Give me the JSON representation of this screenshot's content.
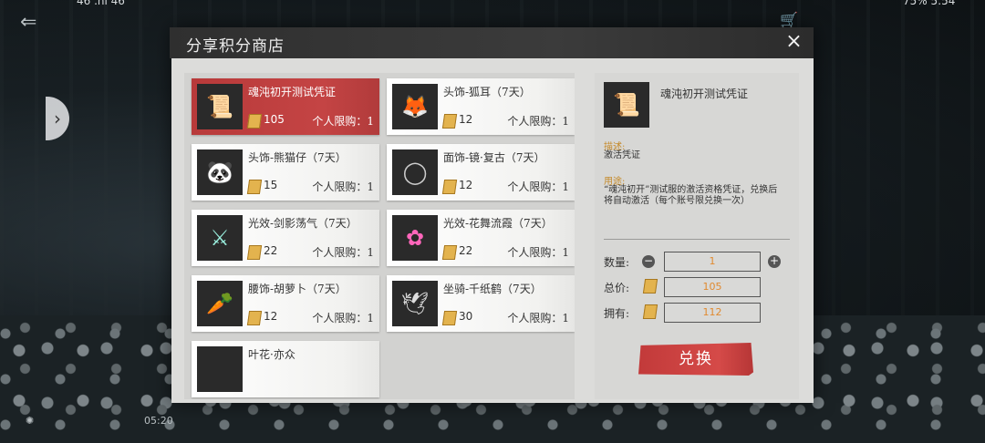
{
  "shop": {
    "title": "分享积分商店",
    "close_icon": "×",
    "items": [
      {
        "name": "魂沌初开测试凭证",
        "price": "105",
        "limit": "个人限购：1",
        "icon": "ticket-icon",
        "glyph": "📜"
      },
      {
        "name": "头饰-狐耳（7天）",
        "price": "12",
        "limit": "个人限购：1",
        "icon": "fox-ears-icon",
        "glyph": "🦊"
      },
      {
        "name": "头饰-熊猫仔（7天）",
        "price": "15",
        "limit": "个人限购：1",
        "icon": "panda-icon",
        "glyph": "🐼"
      },
      {
        "name": "面饰-镜·复古（7天）",
        "price": "12",
        "limit": "个人限购：1",
        "icon": "monocle-icon",
        "glyph": "◯"
      },
      {
        "name": "光效-剑影荡气（7天）",
        "price": "22",
        "limit": "个人限购：1",
        "icon": "sword-effect-icon",
        "glyph": "⚔"
      },
      {
        "name": "光效-花舞流霞（7天）",
        "price": "22",
        "limit": "个人限购：1",
        "icon": "flower-effect-icon",
        "glyph": "✿"
      },
      {
        "name": "腰饰-胡萝卜（7天）",
        "price": "12",
        "limit": "个人限购：1",
        "icon": "carrot-icon",
        "glyph": "🥕"
      },
      {
        "name": "坐骑-千纸鹤（7天）",
        "price": "30",
        "limit": "个人限购：1",
        "icon": "paper-crane-icon",
        "glyph": "🕊"
      },
      {
        "name": "叶花·亦众",
        "price": "",
        "limit": "",
        "icon": "partial-item-icon",
        "glyph": ""
      }
    ]
  },
  "detail": {
    "name": "魂沌初开测试凭证",
    "desc_label": "描述:",
    "desc_text": "激活凭证",
    "usage_label": "用途:",
    "usage_text": "“魂沌初开”测试服的激活资格凭证，兑换后将自动激活（每个账号限兑换一次）",
    "qty_label": "数量:",
    "qty_value": "1",
    "total_label": "总价:",
    "total_value": "105",
    "owned_label": "拥有:",
    "owned_value": "112",
    "minus": "−",
    "plus": "+",
    "exchange_label": "兑换"
  },
  "hud": {
    "timer": "05:20",
    "status_left": "46 .nl 46",
    "status_right": "75% 5:54"
  },
  "colors": {
    "selected_item": "#c44444",
    "exchange_button": "#d54a48",
    "currency_gold": "#e3b34e",
    "label_orange": "#c58a2a"
  }
}
